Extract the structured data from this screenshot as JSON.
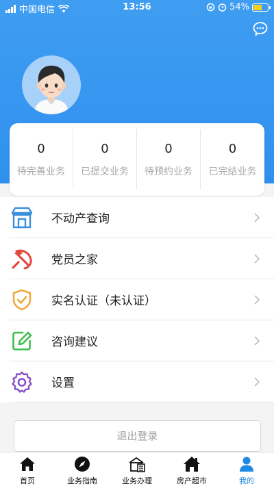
{
  "status_bar": {
    "carrier": "中国电信",
    "time": "13:56",
    "battery": "54%"
  },
  "header": {
    "message_icon": "chat-bubble-icon",
    "avatar_icon": "user-avatar-icon"
  },
  "stats": [
    {
      "count": "0",
      "label": "待完善业务"
    },
    {
      "count": "0",
      "label": "已提交业务"
    },
    {
      "count": "0",
      "label": "待预约业务"
    },
    {
      "count": "0",
      "label": "已完结业务"
    }
  ],
  "menu": [
    {
      "label": "不动产查询",
      "icon": "store-icon",
      "color": "#3a8fdc"
    },
    {
      "label": "党员之家",
      "icon": "hammer-sickle-icon",
      "color": "#e04a3f"
    },
    {
      "label": "实名认证（未认证）",
      "icon": "shield-check-icon",
      "color": "#f0a83a"
    },
    {
      "label": "咨询建议",
      "icon": "edit-icon",
      "color": "#3bbf4a"
    },
    {
      "label": "设置",
      "icon": "gear-icon",
      "color": "#8a4fc9"
    }
  ],
  "logout_label": "退出登录",
  "tabs": [
    {
      "label": "首页",
      "icon": "home-icon"
    },
    {
      "label": "业务指南",
      "icon": "compass-icon"
    },
    {
      "label": "业务办理",
      "icon": "building-icon"
    },
    {
      "label": "房产超市",
      "icon": "house-icon"
    },
    {
      "label": "我的",
      "icon": "person-icon",
      "active": true
    }
  ],
  "colors": {
    "primary": "#2f90ef",
    "active_tab": "#1e88e5"
  }
}
